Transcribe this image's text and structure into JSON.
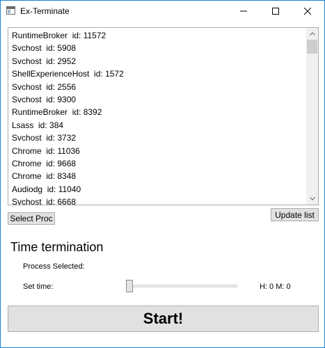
{
  "window": {
    "title": "Ex-Terminate"
  },
  "process_list": {
    "items": [
      "RuntimeBroker  id: 11572",
      "Svchost  id: 5908",
      "Svchost  id: 2952",
      "ShellExperienceHost  id: 1572",
      "Svchost  id: 2556",
      "Svchost  id: 9300",
      "RuntimeBroker  id: 8392",
      "Lsass  id: 384",
      "Svchost  id: 3732",
      "Chrome  id: 11036",
      "Chrome  id: 9668",
      "Chrome  id: 8348",
      "Audiodg  id: 11040",
      "Svchost  id: 6668"
    ]
  },
  "buttons": {
    "select_proc": "Select Proc",
    "update_list": "Update list",
    "start": "Start!"
  },
  "termination": {
    "section_title": "Time termination",
    "process_selected_label": "Process Selected:",
    "set_time_label": "Set time:",
    "time_readout": "H: 0 M: 0",
    "slider_value": 0
  },
  "icons": {
    "app": "app-window-icon",
    "minimize": "minimize-icon",
    "maximize": "maximize-icon",
    "close": "close-icon",
    "scroll_up": "chevron-up-icon",
    "scroll_down": "chevron-down-icon"
  }
}
